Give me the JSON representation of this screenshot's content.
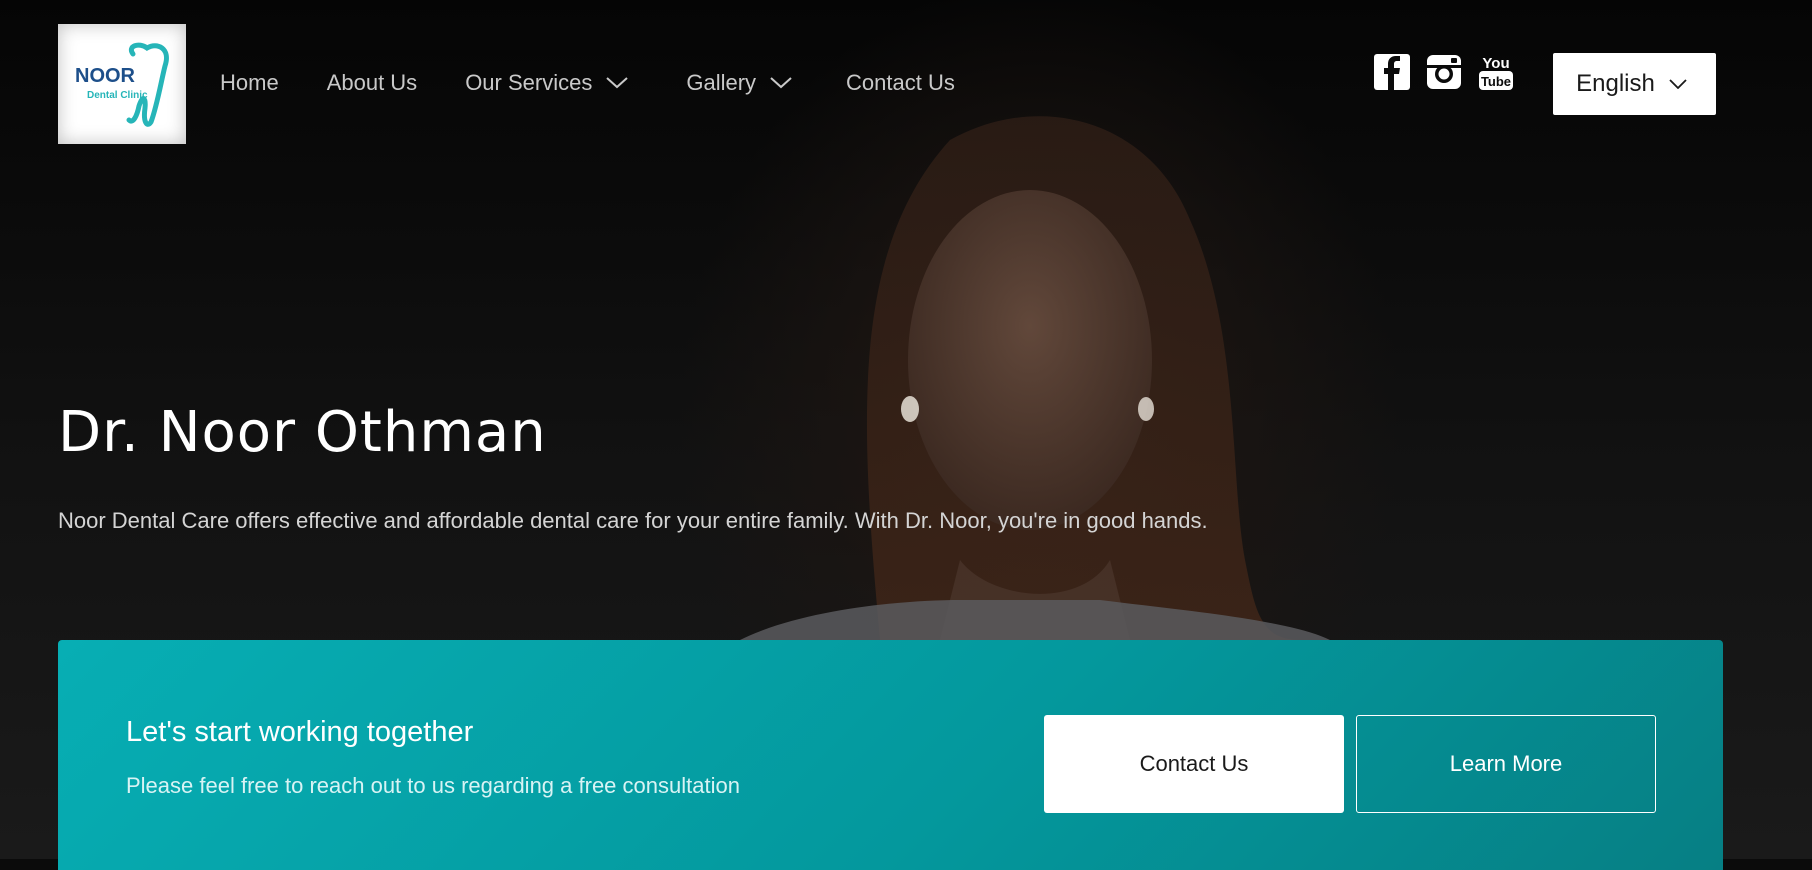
{
  "header": {
    "logo": {
      "line1": "NOOR",
      "line2": "Dental Clinic"
    },
    "nav": [
      {
        "label": "Home",
        "dropdown": false
      },
      {
        "label": "About Us",
        "dropdown": false
      },
      {
        "label": "Our Services",
        "dropdown": true
      },
      {
        "label": "Gallery",
        "dropdown": true
      },
      {
        "label": "Contact Us",
        "dropdown": false
      }
    ],
    "social": [
      "facebook-icon",
      "instagram-icon",
      "youtube-icon"
    ],
    "language": {
      "selected": "English"
    }
  },
  "hero": {
    "title": "Dr. Noor Othman",
    "subtitle": "Noor Dental Care offers effective and affordable dental care for your entire family. With Dr. Noor, you're in good hands."
  },
  "cta": {
    "title": "Let's start working together",
    "subtitle": "Please feel free to reach out to us regarding a free consultation",
    "primary_label": "Contact Us",
    "secondary_label": "Learn More"
  },
  "colors": {
    "accent": "#04a3a8",
    "background": "#0b0b0b"
  }
}
